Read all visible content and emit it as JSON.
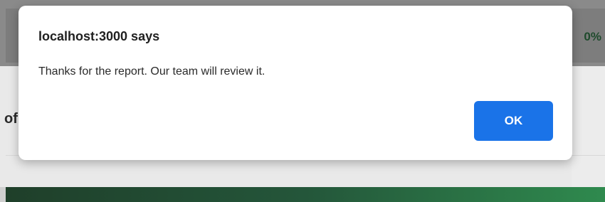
{
  "background": {
    "badge_text": "0%",
    "fragment_text": "of"
  },
  "dialog": {
    "title": "localhost:3000 says",
    "message": "Thanks for the report. Our team will review it.",
    "ok_label": "OK"
  },
  "colors": {
    "accent": "#1a73e8",
    "overlay": "#cfcfcf"
  }
}
